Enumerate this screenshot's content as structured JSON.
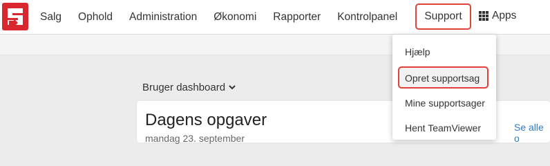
{
  "nav": {
    "items": [
      "Salg",
      "Ophold",
      "Administration",
      "Økonomi",
      "Rapporter",
      "Kontrolpanel"
    ],
    "support_label": "Support",
    "apps_label": "Apps"
  },
  "dashboard": {
    "selector_label": "Bruger dashboard",
    "card_title": "Dagens opgaver",
    "card_subtitle": "mandag 23. september",
    "see_all": "Se alle o"
  },
  "support_menu": {
    "items": [
      "Hjælp",
      "Opret supportsag",
      "Mine supportsager",
      "Hent TeamViewer"
    ]
  },
  "colors": {
    "brand": "#d8272f",
    "highlight": "#e0413b",
    "link": "#2f7bbf"
  }
}
